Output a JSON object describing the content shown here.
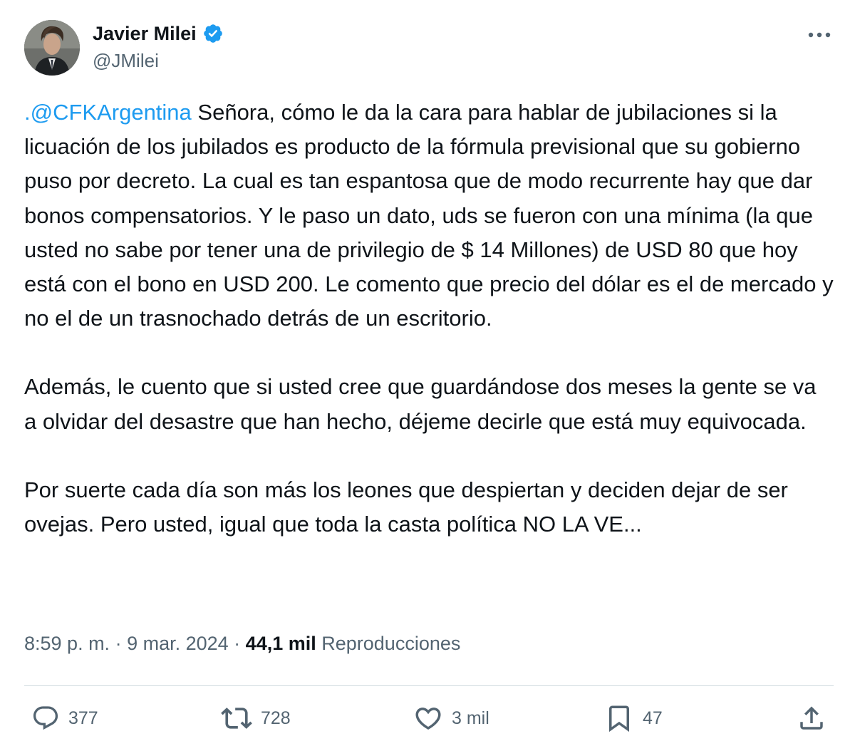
{
  "author": {
    "display_name": "Javier Milei",
    "handle": "@JMilei",
    "verified": true
  },
  "tweet": {
    "mention": ".@CFKArgentina",
    "paragraph_1_rest": " Señora, cómo le da la cara para hablar de jubilaciones si la licuación de los jubilados es producto de la fórmula previsional que su gobierno puso por decreto. La cual es tan espantosa que de modo recurrente hay que dar bonos compensatorios. Y le paso un dato, uds se fueron con una mínima (la que usted no sabe por tener una de privilegio de $ 14 Millones) de USD 80 que hoy está con el bono en USD 200. Le comento que precio del dólar es el de mercado y no el de un trasnochado detrás de un escritorio.",
    "paragraph_2": "Además, le cuento que si usted cree que guardándose dos meses la gente se va a olvidar del desastre que han hecho, déjeme decirle que está muy equivocada.",
    "paragraph_3": "Por suerte cada día son más los leones que despiertan y deciden dejar de ser ovejas. Pero usted, igual que toda la casta política NO LA VE..."
  },
  "meta": {
    "time": "8:59 p. m.",
    "separator": " · ",
    "date": "9 mar. 2024",
    "views_count": "44,1 mil",
    "views_label": "Reproducciones"
  },
  "actions": {
    "replies": "377",
    "reposts": "728",
    "likes": "3 mil",
    "bookmarks": "47"
  },
  "colors": {
    "text": "#0f1419",
    "secondary": "#536471",
    "accent": "#1d9bf0",
    "divider": "#cfd9de"
  },
  "icons": [
    "verified-badge-icon",
    "more-options-icon",
    "reply-icon",
    "repost-icon",
    "like-icon",
    "bookmark-icon",
    "share-icon"
  ]
}
